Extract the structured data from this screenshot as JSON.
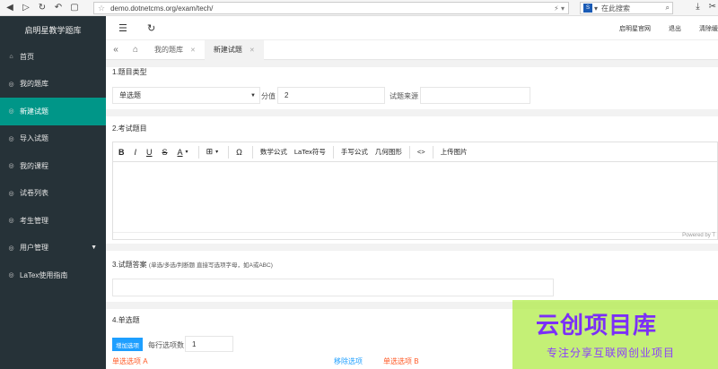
{
  "browser": {
    "url": "demo.dotnetcms.org/exam/tech/",
    "search_placeholder": "在此搜索",
    "search_logo": "S"
  },
  "sidebar": {
    "title": "启明星教学题库",
    "items": [
      {
        "label": "首页",
        "icon": "home-icon"
      },
      {
        "label": "我的题库",
        "icon": "library-icon"
      },
      {
        "label": "新建试题",
        "icon": "add-icon",
        "active": true
      },
      {
        "label": "导入试题",
        "icon": "import-icon"
      },
      {
        "label": "我的课程",
        "icon": "course-icon"
      },
      {
        "label": "试卷列表",
        "icon": "list-icon"
      },
      {
        "label": "考生管理",
        "icon": "user-icon"
      },
      {
        "label": "用户管理",
        "icon": "users-icon"
      },
      {
        "label": "LaTex使用指南",
        "icon": "guide-icon"
      }
    ]
  },
  "header": {
    "links": [
      "启明星官网",
      "退出",
      "清除缓"
    ]
  },
  "tabs": [
    {
      "label": "我的题库"
    },
    {
      "label": "新建试题",
      "active": true
    }
  ],
  "form": {
    "section1_title": "1.题目类型",
    "type_value": "单选题",
    "score_label": "分值",
    "score_value": "2",
    "source_label": "试题来源",
    "section2_title": "2.考试题目",
    "toolbar": [
      "B",
      "I",
      "U",
      "S",
      "A",
      "Ω",
      "数学公式",
      "LaTex符号",
      "手写公式",
      "几何图形",
      "<>",
      "上传图片"
    ],
    "powered_by": "Powered by T",
    "section3_title": "3.试题答案",
    "section3_hint": "(单选/多选/判断题 直接写选项字母，如A或ABC)",
    "section4_title": "4.单选题",
    "add_option_label": "增加选项",
    "per_row_label": "每行选项数",
    "per_row_value": "1",
    "option_a_label": "单选选项 A",
    "remove_option_label": "移除选项",
    "option_b_label": "单选选项 B"
  },
  "watermark": {
    "title": "云创项目库",
    "subtitle": "专注分享互联网创业项目"
  },
  "colors": {
    "sidebar_bg": "#263238",
    "active_item": "#009688",
    "primary_button": "#1e9fff",
    "option_label": "#ff5722"
  }
}
